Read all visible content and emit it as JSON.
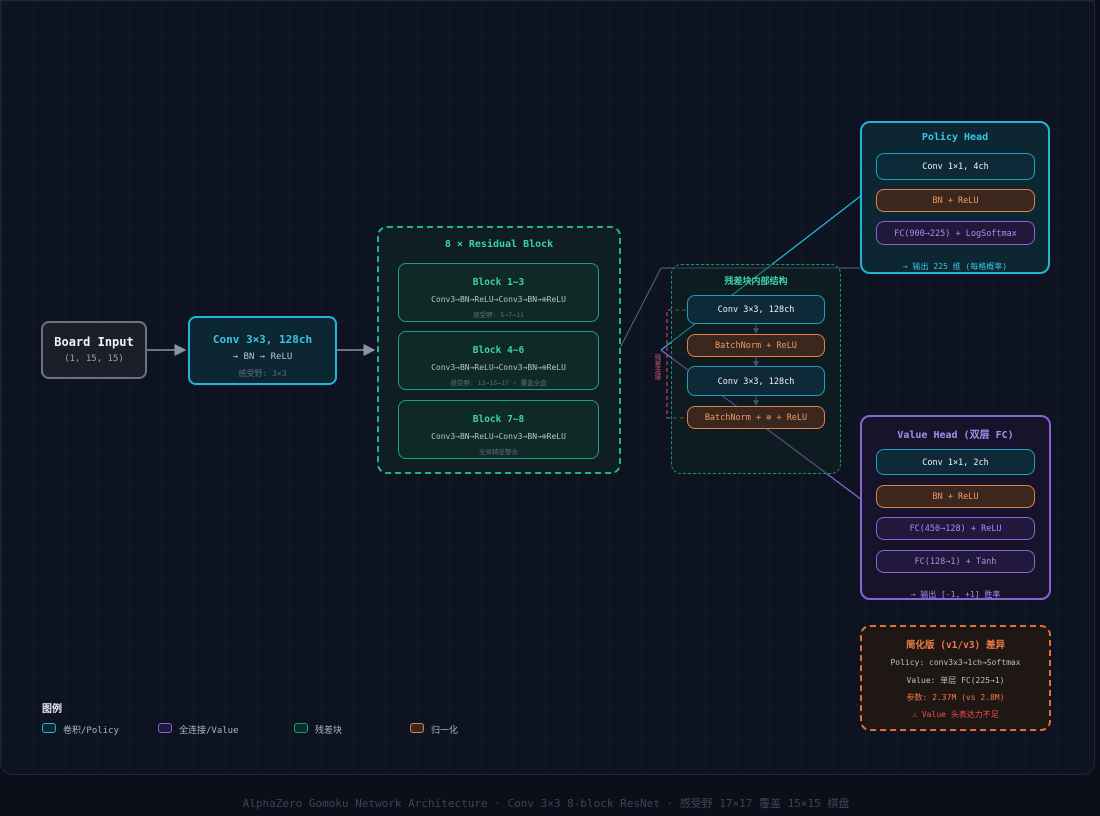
{
  "input": {
    "title": "Board Input",
    "shape": "(1, 15, 15)"
  },
  "stem": {
    "title": "Conv 3×3, 128ch",
    "sub": "→ BN → ReLU",
    "rf": "感受野: 3×3"
  },
  "residual": {
    "title": "8 × Residual Block",
    "blocks": [
      {
        "title": "Block 1~3",
        "desc": "Conv3→BN→ReLU→Conv3→BN→⊕ReLU",
        "rf": "感受野: 5→7→11"
      },
      {
        "title": "Block 4~6",
        "desc": "Conv3→BN→ReLU→Conv3→BN→⊕ReLU",
        "rf": "感受野: 13→15→17 ✓ 覆盖全盘"
      },
      {
        "title": "Block 7~8",
        "desc": "Conv3→BN→ReLU→Conv3→BN→⊕ReLU",
        "rf": "全局特征整合"
      }
    ]
  },
  "inner": {
    "title": "残差块内部结构",
    "skip_label": "残差连接",
    "layers": [
      "Conv 3×3, 128ch",
      "BatchNorm + ReLU",
      "Conv 3×3, 128ch",
      "BatchNorm + ⊕ + ReLU"
    ]
  },
  "policy": {
    "title": "Policy Head",
    "layers": [
      "Conv 1×1, 4ch",
      "BN + ReLU",
      "FC(900→225) + LogSoftmax"
    ],
    "output": "→ 输出 225 维 (每格概率)"
  },
  "value": {
    "title": "Value Head (双层 FC)",
    "layers": [
      "Conv 1×1, 2ch",
      "BN + ReLU",
      "FC(450→128) + ReLU",
      "FC(128→1) + Tanh"
    ],
    "output": "→ 输出 [-1, +1] 胜率"
  },
  "simplified": {
    "title": "简化版 (v1/v3) 差异",
    "line1": "Policy: conv3x3→1ch→Softmax",
    "line2": "Value: 单层 FC(225→1)",
    "line3": "参数: 2.37M (vs 2.8M)",
    "line4": "⚠ Value 头表达力不足"
  },
  "legend": {
    "title": "图例",
    "items": [
      {
        "label": "卷积/Policy",
        "color": "#22b6d6"
      },
      {
        "label": "全连接/Value",
        "color": "#8b63d6"
      },
      {
        "label": "残差块",
        "color": "#1f9f7f"
      },
      {
        "label": "归一化",
        "color": "#d9824a"
      }
    ]
  },
  "footer": "AlphaZero Gomoku Network Architecture · Conv 3×3 8-block ResNet · 感受野 17×17 覆盖 15×15 棋盘"
}
